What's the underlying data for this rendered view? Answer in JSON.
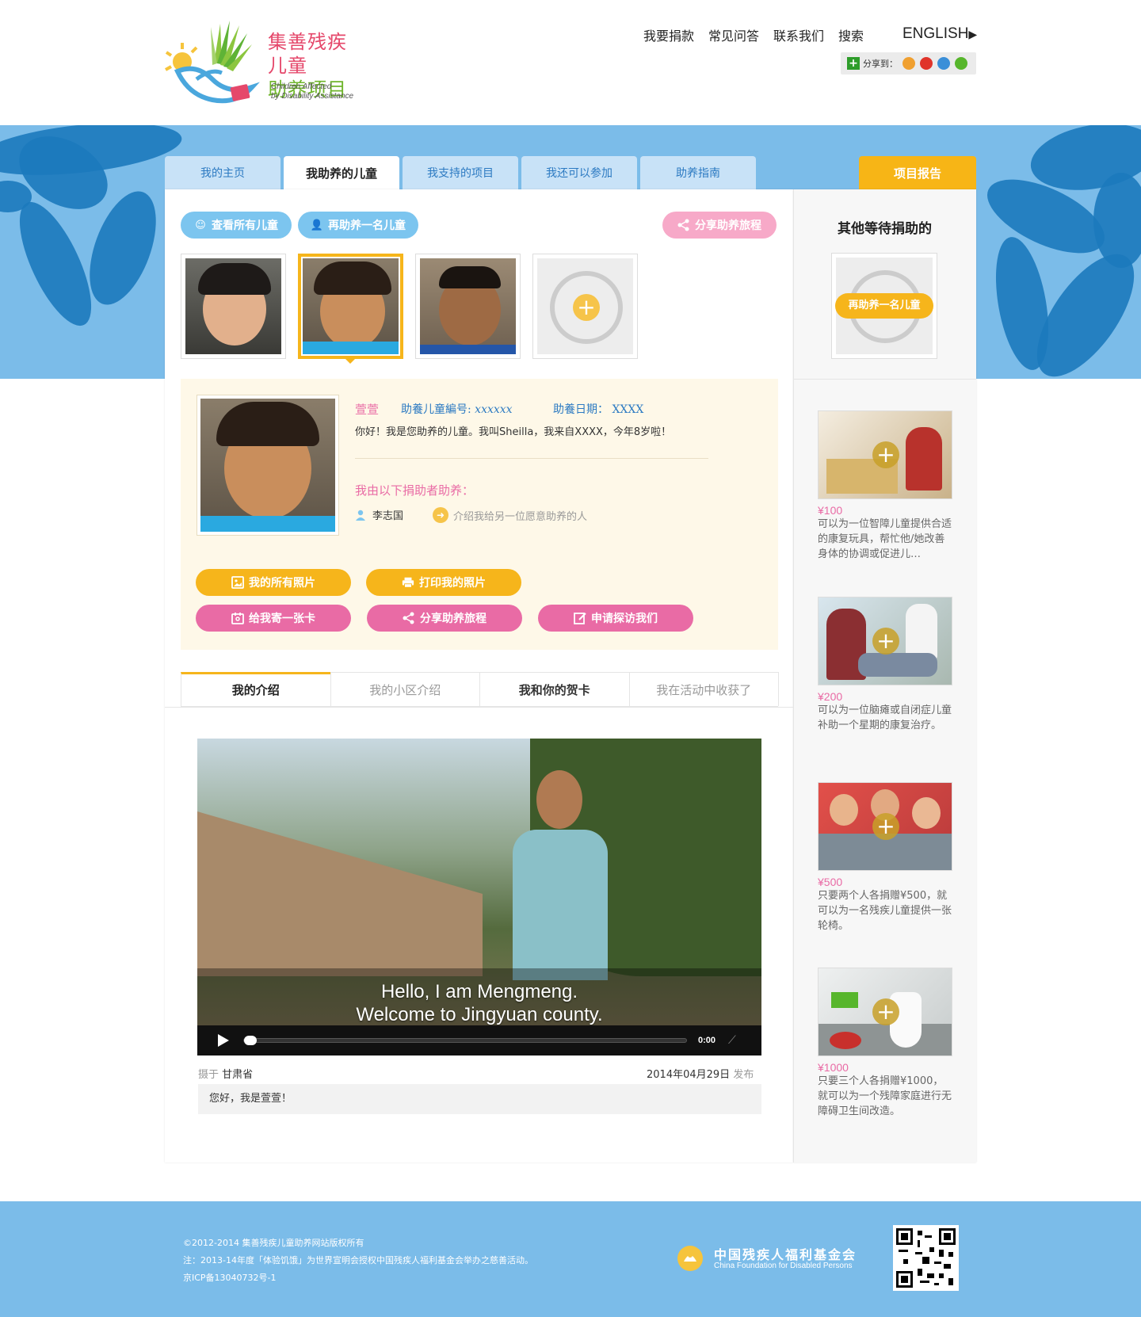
{
  "header": {
    "logo_title_1": "集善残疾儿童",
    "logo_title_2": "助养项目",
    "logo_sub_1": "Children Affected",
    "logo_sub_2": "by Disability Assistance",
    "nav": [
      "我要捐款",
      "常见问答",
      "联系我们",
      "搜索"
    ],
    "lang": "ENGLISH",
    "share_label": "分享到："
  },
  "tabs": {
    "items": [
      "我的主页",
      "我助养的儿童",
      "我支持的项目",
      "我还可以参加",
      "助养指南"
    ],
    "active": 1,
    "report": "项目报告"
  },
  "toolbar": {
    "view_all": "查看所有儿童",
    "sponsor_another": "再助养一名儿童",
    "share_journey": "分享助养旅程"
  },
  "child": {
    "name": "萱萱",
    "number_label": "助養儿童編号:",
    "number_value": "xxxxxx",
    "date_label": "助養日期：",
    "date_value": "XXXX",
    "intro": "你好！我是您助养的儿童。我叫Sheilla，我来自XXXX，今年8岁啦！",
    "sponsor_title": "我由以下捐助者助养：",
    "sponsor_name": "李志国",
    "introduce_link": "介绍我给另一位愿意助养的人"
  },
  "actions": {
    "all_photos": "我的所有照片",
    "print_photos": "打印我的照片",
    "send_card": "给我寄一张卡",
    "share_journey": "分享助养旅程",
    "request_visit": "申请探访我们"
  },
  "sub_tabs": [
    "我的介绍",
    "我的小区介绍",
    "我和你的贺卡",
    "我在活动中收获了"
  ],
  "video": {
    "subtitle_1": "Hello, I am Mengmeng.",
    "subtitle_2": "Welcome to Jingyuan county.",
    "time": "0:00",
    "location_label": "摄于",
    "location": "甘肃省",
    "date": "2014年04月29日",
    "date_suffix": "发布",
    "caption": "您好，我是萱萱！"
  },
  "sidebar": {
    "title": "其他等待捐助的",
    "add_button": "再助养一名儿童",
    "donations": [
      {
        "amount": "¥100",
        "desc": "可以为一位智障儿童提供合适的康复玩具，帮忙他/她改善身体的协调或促进儿…"
      },
      {
        "amount": "¥200",
        "desc": "可以为一位脑瘫或自闭症儿童补助一个星期的康复治疗。"
      },
      {
        "amount": "¥500",
        "desc": "只要两个人各捐赠¥500，就可以为一名残疾儿童提供一张轮椅。"
      },
      {
        "amount": "¥1000",
        "desc": "只要三个人各捐赠¥1000，就可以为一个残障家庭进行无障碍卫生间改造。"
      }
    ]
  },
  "footer": {
    "line1": "©2012-2014 集善残疾儿童助养网站版权所有",
    "line2": "注：2013-14年度「体验饥饿」为世界宣明会授权中国残疾人福利基金会举办之慈善活动。",
    "line3": "京ICP备13040732号-1",
    "org_cn": "中国残疾人福利基金会",
    "org_en": "China Foundation for Disabled Persons"
  },
  "colors": {
    "banner_blue": "#7bbce9",
    "splat_blue": "#1c79bd",
    "accent_yellow": "#f6b51b",
    "accent_pink": "#e96ba5",
    "link_blue": "#2c7ac2"
  }
}
